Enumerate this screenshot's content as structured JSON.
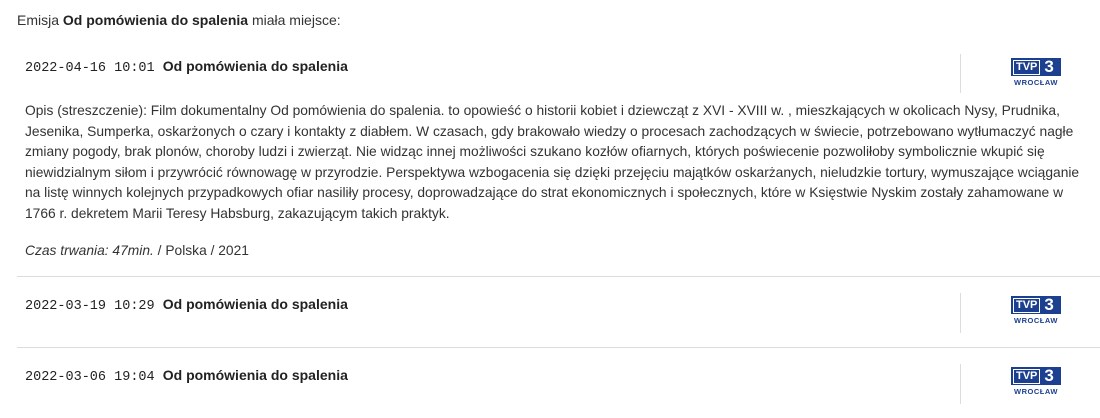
{
  "intro": {
    "prefix": "Emisja",
    "title": "Od pomówienia do spalenia",
    "suffix": "miała miejsce:"
  },
  "entries": [
    {
      "datetime": "2022-04-16 10:01",
      "title": "Od pomówienia do spalenia",
      "channel_logo": "TVP3",
      "channel_city": "WROCŁAW",
      "description": "Opis (streszczenie): Film dokumentalny Od pomówienia do spalenia. to opowieść o historii kobiet i dziewcząt z XVI - XVIII w. , mieszkających w okolicach Nysy, Prudnika, Jesenika, Sumperka, oskarżonych o czary i kontakty z diabłem. W czasach, gdy brakowało wiedzy o procesach zachodzących w świecie, potrzebowano wytłumaczyć nagłe zmiany pogody, brak plonów, choroby ludzi i zwierząt. Nie widząc innej możliwości szukano kozłów ofiarnych, których poświecenie pozwoliłoby symbolicznie wkupić się niewidzialnym siłom i przywrócić równowagę w przyrodzie. Perspektywa wzbogacenia się dzięki przejęciu majątków oskarżanych, nieludzkie tortury, wymuszające wciąganie na listę winnych kolejnych przypadkowych ofiar nasiliły procesy, doprowadzające do strat ekonomicznych i społecznych, które w Księstwie Nyskim zostały zahamowane w 1766 r. dekretem Marii Teresy Habsburg, zakazującym takich praktyk.",
      "duration_label": "Czas trwania: 47min.",
      "country_year": " / Polska / 2021"
    },
    {
      "datetime": "2022-03-19 10:29",
      "title": "Od pomówienia do spalenia",
      "channel_logo": "TVP3",
      "channel_city": "WROCŁAW"
    },
    {
      "datetime": "2022-03-06 19:04",
      "title": "Od pomówienia do spalenia",
      "channel_logo": "TVP3",
      "channel_city": "WROCŁAW"
    }
  ],
  "colors": {
    "logo_blue": "#1d3f8f",
    "divider": "#dcdcdc"
  }
}
